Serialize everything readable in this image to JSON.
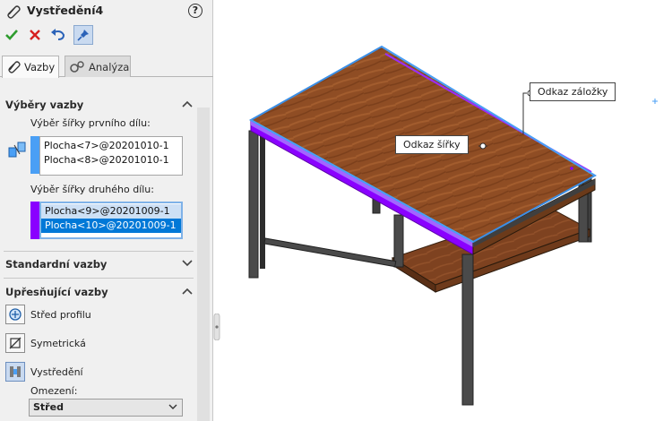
{
  "panel": {
    "title": "Vystředění4",
    "help": "?",
    "tabs": [
      {
        "label": "Vazby"
      },
      {
        "label": "Analýza"
      }
    ],
    "sections": {
      "selections": {
        "title": "Výběry vazby",
        "first_label": "Výběr šířky prvního dílu:",
        "first_items": [
          "Plocha<7>@20201010-1",
          "Plocha<8>@20201010-1"
        ],
        "second_label": "Výběr šířky druhého dílu:",
        "second_items": [
          "Plocha<9>@20201009-1",
          "Plocha<10>@20201009-1"
        ]
      },
      "standard": {
        "title": "Standardní vazby"
      },
      "advanced": {
        "title": "Upřesňující vazby",
        "options": [
          {
            "label": "Střed profilu"
          },
          {
            "label": "Symetrická"
          },
          {
            "label": "Vystředění"
          }
        ],
        "constraint_label": "Omezení:",
        "constraint_value": "Střed"
      }
    }
  },
  "viewport": {
    "callout_width": "Odkaz šířky",
    "callout_tab": "Odkaz záložky"
  },
  "colors": {
    "first_selection": "#4a9ff5",
    "second_selection": "#8a00ff",
    "accept": "#2e9c2e",
    "cancel": "#d62020",
    "wood": "#8a4a22"
  }
}
